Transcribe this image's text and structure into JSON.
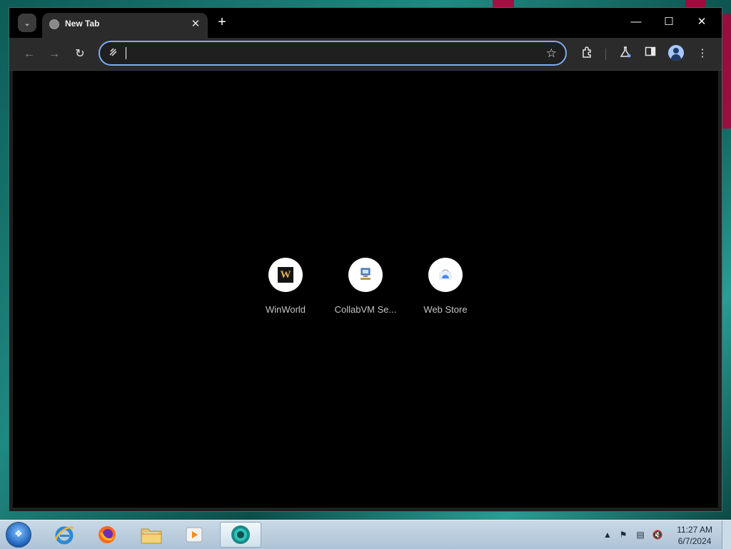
{
  "browser": {
    "tab": {
      "title": "New Tab",
      "close_symbol": "✕"
    },
    "new_tab_symbol": "+",
    "window_controls": {
      "minimize": "—",
      "maximize": "☐",
      "close": "✕"
    },
    "toolbar": {
      "back_symbol": "←",
      "forward_symbol": "→",
      "reload_symbol": "↻",
      "omnibox": {
        "value": "",
        "placeholder": ""
      },
      "star_symbol": "☆"
    }
  },
  "shortcuts": [
    {
      "label": "WinWorld",
      "icon_text": "W"
    },
    {
      "label": "CollabVM Se...",
      "icon_text": ""
    },
    {
      "label": "Web Store",
      "icon_text": ""
    }
  ],
  "taskbar": {
    "apps": [
      "internet-explorer",
      "firefox",
      "file-explorer",
      "media-player",
      "chrome-canary"
    ],
    "clock": {
      "time": "11:27 AM",
      "date": "6/7/2024"
    }
  },
  "colors": {
    "omnibox_focus": "#7cacf8",
    "page_background": "#000000",
    "tab_background": "#2b2b2b"
  }
}
